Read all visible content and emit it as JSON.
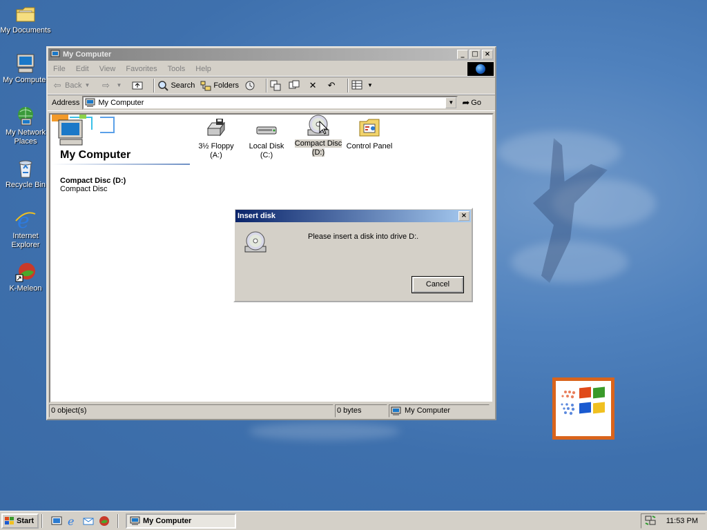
{
  "desktop_icons": [
    {
      "label": "My Documents",
      "icon": "folder-icon"
    },
    {
      "label": "My Computer",
      "icon": "computer-icon"
    },
    {
      "label": "My Network Places",
      "icon": "network-icon"
    },
    {
      "label": "Recycle Bin",
      "icon": "recycle-bin-icon"
    },
    {
      "label": "Internet Explorer",
      "icon": "internet-explorer-icon"
    },
    {
      "label": "K-Meleon",
      "icon": "k-meleon-icon"
    }
  ],
  "window": {
    "title": "My Computer",
    "menu": [
      "File",
      "Edit",
      "View",
      "Favorites",
      "Tools",
      "Help"
    ],
    "toolbar": {
      "back": "Back",
      "search": "Search",
      "folders": "Folders"
    },
    "address": {
      "label": "Address",
      "value": "My Computer",
      "go": "Go"
    },
    "left_pane": {
      "heading": "My Computer",
      "selected_name": "Compact Disc (D:)",
      "selected_type": "Compact Disc"
    },
    "items": [
      {
        "label": "3½ Floppy (A:)",
        "icon": "floppy-drive-icon"
      },
      {
        "label": "Local Disk (C:)",
        "icon": "hard-disk-icon"
      },
      {
        "label": "Compact Disc (D:)",
        "icon": "cd-drive-icon"
      },
      {
        "label": "Control Panel",
        "icon": "control-panel-icon"
      }
    ],
    "status": {
      "objects": "0 object(s)",
      "size": "0 bytes",
      "zone": "My Computer"
    }
  },
  "dialog": {
    "title": "Insert disk",
    "message": "Please insert a disk into drive D:.",
    "cancel": "Cancel"
  },
  "taskbar": {
    "start": "Start",
    "task": "My Computer",
    "clock": "11:53 PM"
  },
  "colors": {
    "desktop": "#3a6ea5",
    "active_title": "#0a246a",
    "inactive_title": "#808080",
    "logo_frame": "#d9641c"
  }
}
